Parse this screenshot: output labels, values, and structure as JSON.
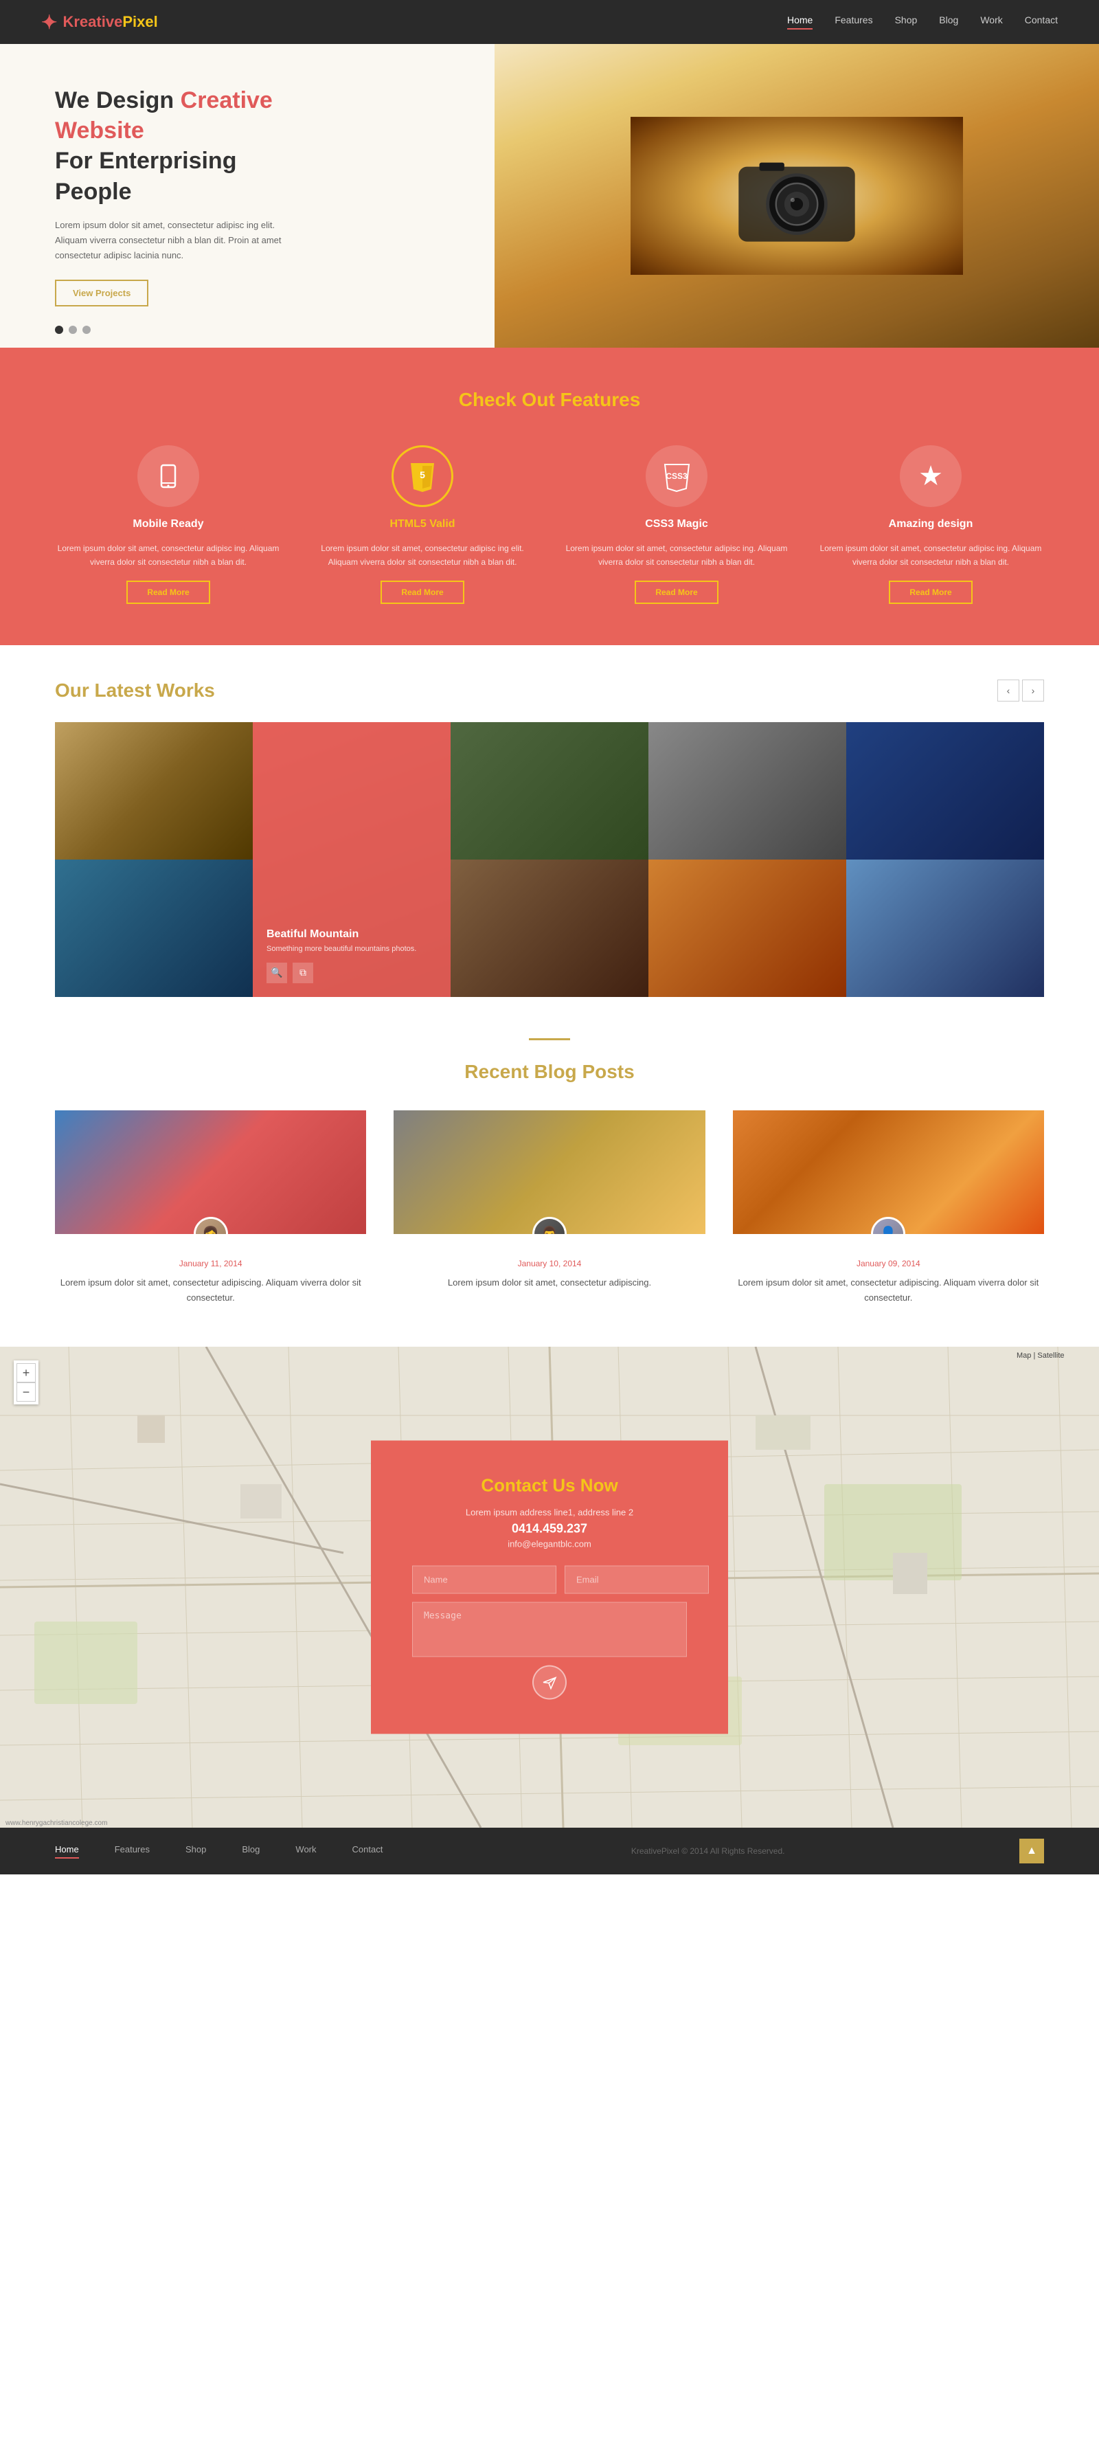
{
  "site": {
    "name": "KreativePixel",
    "logo_kreative": "Kreative",
    "logo_pixel": "Pixel"
  },
  "nav": {
    "items": [
      {
        "label": "Home",
        "active": true
      },
      {
        "label": "Features",
        "active": false
      },
      {
        "label": "Shop",
        "active": false
      },
      {
        "label": "Blog",
        "active": false
      },
      {
        "label": "Work",
        "active": false
      },
      {
        "label": "Contact",
        "active": false
      }
    ]
  },
  "hero": {
    "line1": "We Design ",
    "highlight": "Creative Website",
    "line2": "For Enterprising People",
    "body": "Lorem ipsum dolor sit amet, consectetur adipisc ing elit. Aliquam viverra consectetur nibh a blan dit. Proin at amet consectetur adipisc lacinia nunc.",
    "cta_label": "View Projects",
    "dots": [
      true,
      false,
      false
    ]
  },
  "features": {
    "section_title_normal": "Check Out",
    "section_title_highlight": "Features",
    "items": [
      {
        "icon": "📱",
        "title_normal": "Mobile Ready",
        "title_highlight": false,
        "description": "Lorem ipsum dolor sit amet, consectetur adipisc ing. Aliquam viverra  dolor sit consectetur nibh a blan dit.",
        "cta": "Read More"
      },
      {
        "icon": "5",
        "title_normal": "HTML5 Valid",
        "title_highlight": true,
        "description": "Lorem ipsum dolor sit amet, consectetur adipisc ing elit. Aliquam viverra  dolor sit consectetur nibh a blan dit.",
        "cta": "Read More"
      },
      {
        "icon": "CSS3",
        "title_normal": "CSS3 Magic",
        "title_highlight": false,
        "description": "Lorem ipsum dolor sit amet, consectetur adipisc ing. Aliquam viverra  dolor sit consectetur nibh a blan dit.",
        "cta": "Read More"
      },
      {
        "icon": "★",
        "title_normal": "Amazing design",
        "title_highlight": false,
        "description": "Lorem ipsum dolor sit amet, consectetur adipisc ing. Aliquam viverra  dolor sit consectetur nibh a blan dit.",
        "cta": "Read More"
      }
    ]
  },
  "works": {
    "section_title_normal": "Our Latest",
    "section_title_highlight": "Works",
    "featured_title": "Beatiful Mountain",
    "featured_desc": "Something more beautiful mountains photos."
  },
  "blog": {
    "section_title_normal": "Recent",
    "section_title_highlight": "Blog Posts",
    "posts": [
      {
        "date": "January 11, 2014",
        "text": "Lorem ipsum dolor sit amet, consectetur adipiscing. Aliquam viverra  dolor sit consectetur."
      },
      {
        "date": "January 10, 2014",
        "text": "Lorem ipsum dolor sit amet, consectetur adipiscing."
      },
      {
        "date": "January 09, 2014",
        "text": "Lorem ipsum dolor sit amet, consectetur adipiscing. Aliquam viverra  dolor sit consectetur."
      }
    ]
  },
  "contact": {
    "title": "Contact Us Now",
    "address": "Lorem ipsum address line1, address line 2",
    "phone": "0414.459.237",
    "email": "info@elegantblc.com",
    "name_placeholder": "Name",
    "email_placeholder": "Email",
    "message_placeholder": "Message"
  },
  "footer": {
    "nav_items": [
      "Home",
      "Features",
      "Shop",
      "Blog",
      "Work",
      "Contact"
    ],
    "copyright": "KreativePixel © 2014 All Rights Reserved."
  }
}
